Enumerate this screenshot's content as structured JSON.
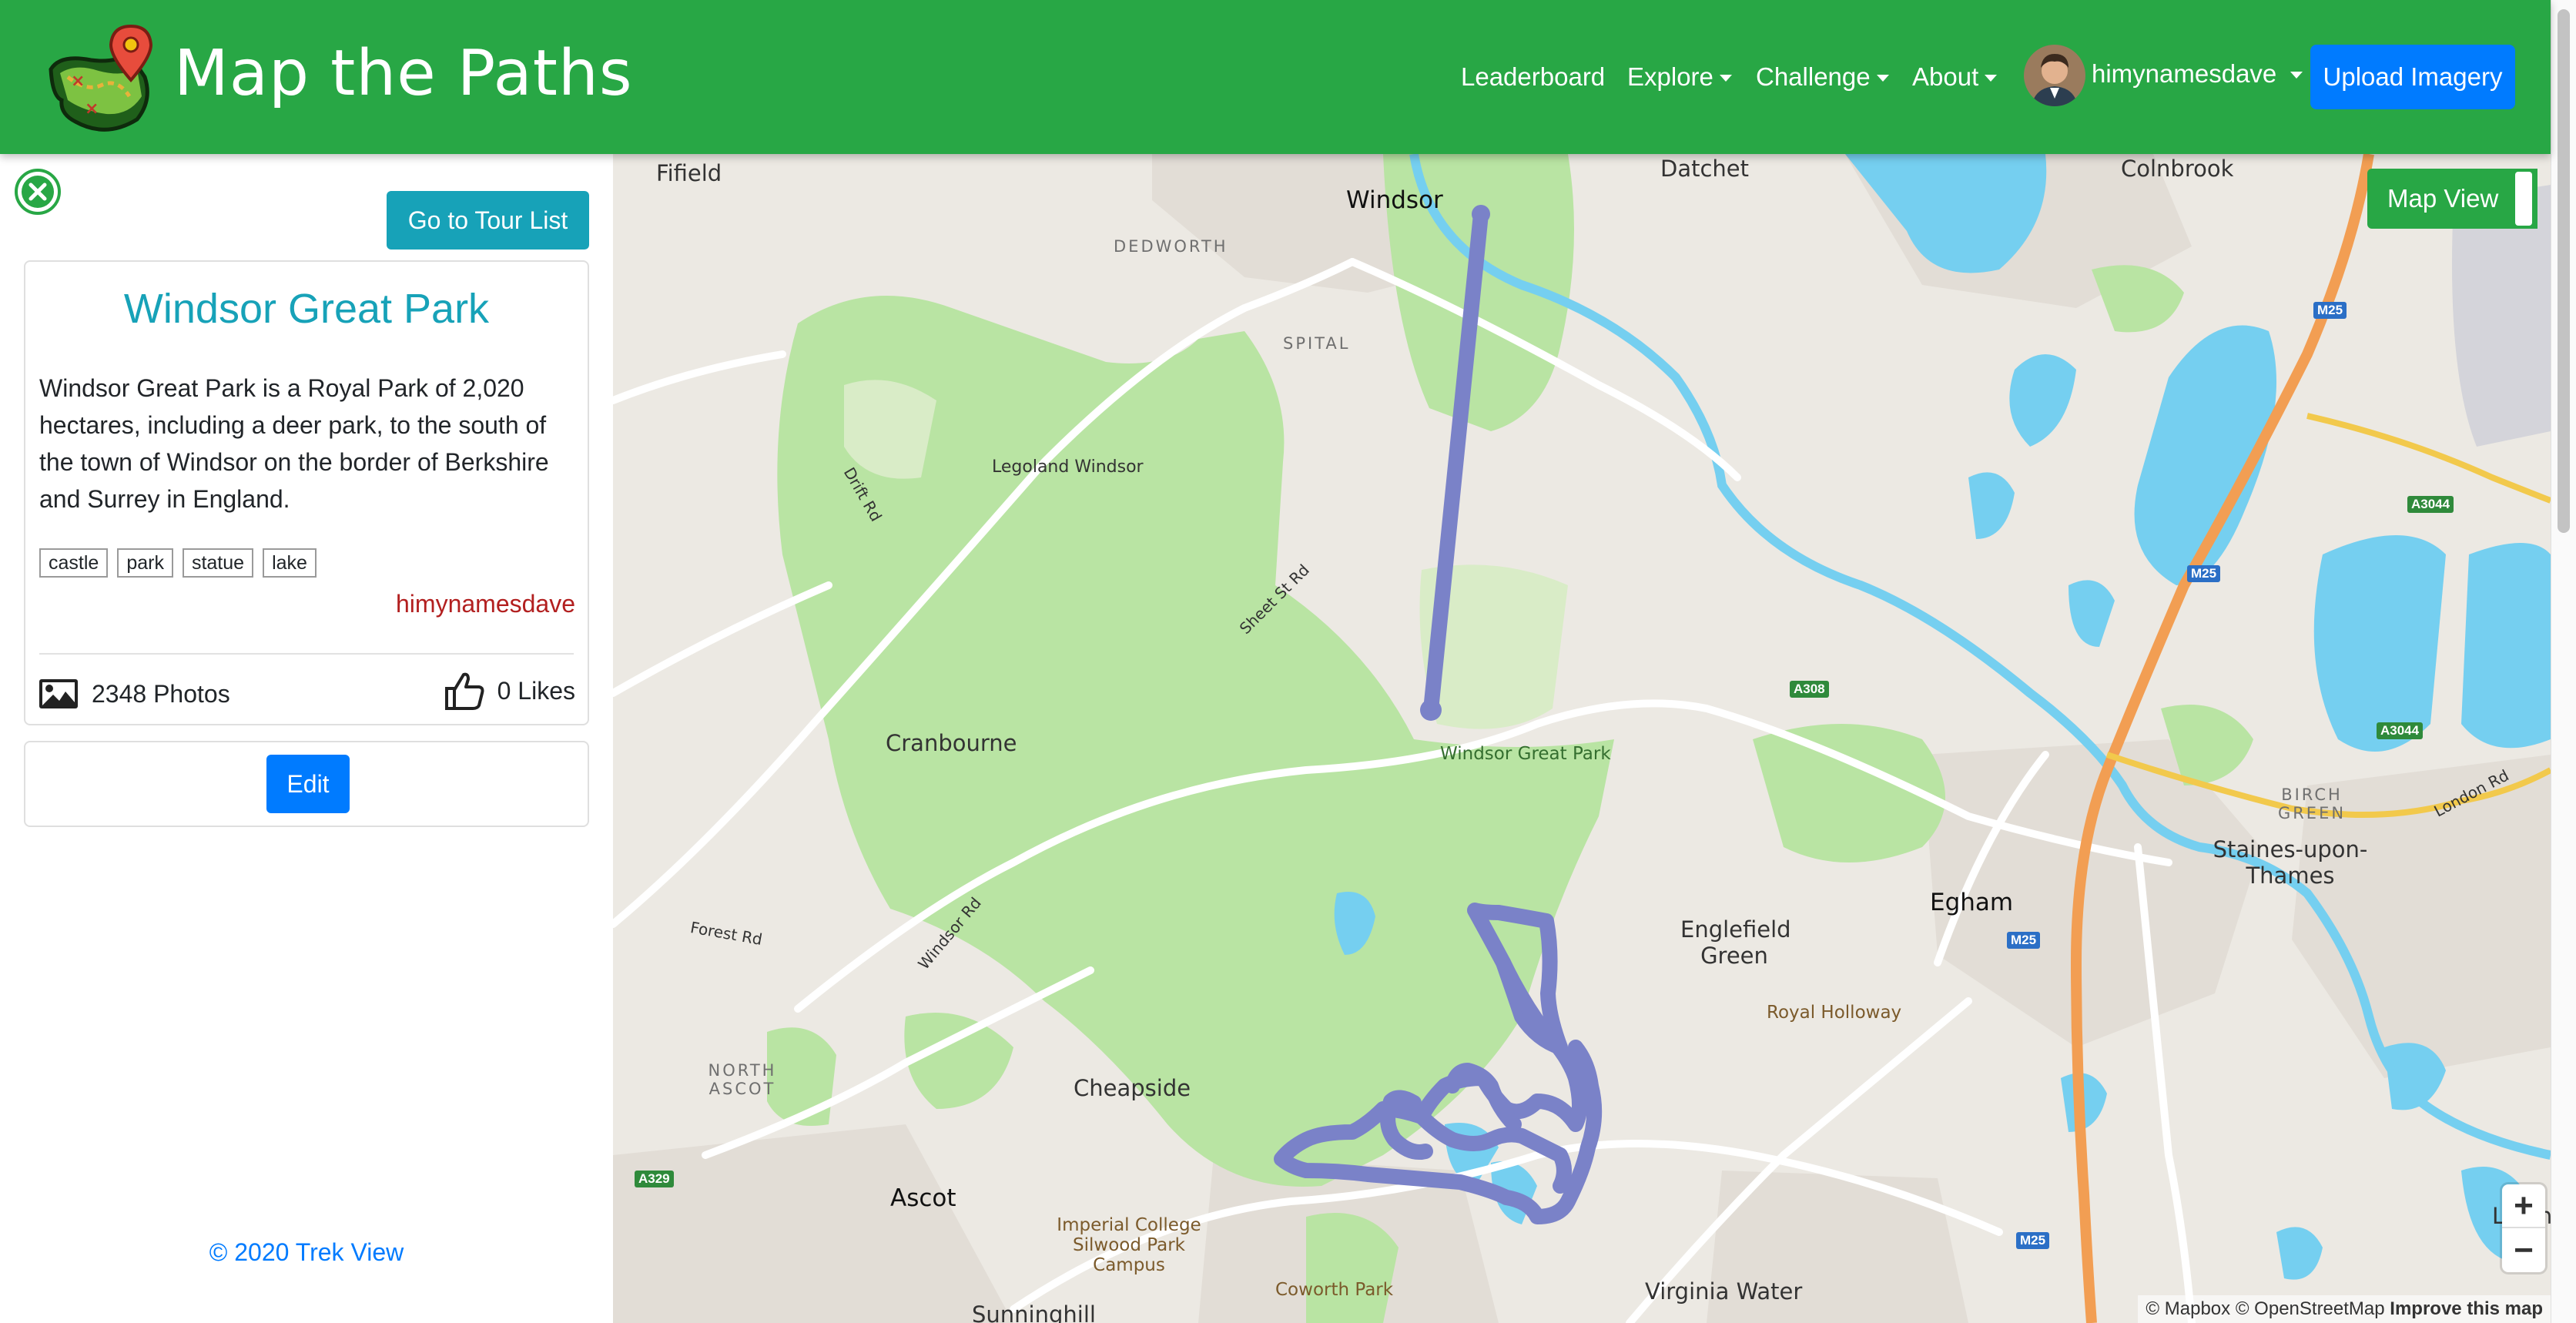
{
  "header": {
    "brand_title": "Map the Paths",
    "nav": [
      "Leaderboard",
      "Explore",
      "Challenge",
      "About"
    ],
    "username": "himynamesdave",
    "upload_button": "Upload Imagery"
  },
  "sidebar": {
    "go_to_tour_list": "Go to Tour List",
    "tour": {
      "title": "Windsor Great Park",
      "description": "Windsor Great Park is a Royal Park of 2,020 hectares, including a deer park, to the south of the town of Windsor on the border of Berkshire and Surrey in England.",
      "tags": [
        "castle",
        "park",
        "statue",
        "lake"
      ],
      "author": "himynamesdave",
      "photos": "2348 Photos",
      "likes": "0 Likes"
    },
    "edit_button": "Edit",
    "footer": "© 2020 Trek View"
  },
  "map": {
    "map_view_button": "Map View",
    "zoom_in": "+",
    "zoom_out": "−",
    "attribution": {
      "mapbox": "© Mapbox",
      "osm": "© OpenStreetMap",
      "improve": "Improve this map"
    },
    "places": {
      "fifield": "Fifield",
      "windsor": "Windsor",
      "datchet": "Datchet",
      "colnbrook": "Colnbrook",
      "dedworth": "DEDWORTH",
      "spital": "SPITAL",
      "legoland": "Legoland Windsor",
      "drift_rd": "Drift Rd",
      "sheet_st_rd": "Sheet St Rd",
      "cranbourne": "Cranbourne",
      "windsor_great_park": "Windsor Great Park",
      "forest_rd": "Forest Rd",
      "windsor_rd": "Windsor Rd",
      "north_ascot": "NORTH ASCOT",
      "cheapside": "Cheapside",
      "ascot": "Ascot",
      "imperial_college": "Imperial College Silwood Park Campus",
      "coworth_park": "Coworth Park",
      "sunninghill": "Sunninghill",
      "virginia_water": "Virginia Water",
      "englefield_green": "Englefield Green",
      "royal_holloway": "Royal Holloway",
      "egham": "Egham",
      "staines": "Staines-upon-Thames",
      "birch_green": "BIRCH GREEN",
      "london_rd": "London Rd",
      "laleham": "Laleham",
      "m25_a": "M25",
      "m25_b": "M25",
      "m25_c": "M25",
      "m25_d": "M25",
      "a308": "A308",
      "a3044_a": "A3044",
      "a3044_b": "A3044",
      "a329": "A329"
    }
  },
  "colors": {
    "navbar": "#28a745",
    "primary": "#007bff",
    "info": "#17a2b8",
    "route": "#7a82c8",
    "park": "#b6e39e",
    "water": "#75cff0"
  }
}
